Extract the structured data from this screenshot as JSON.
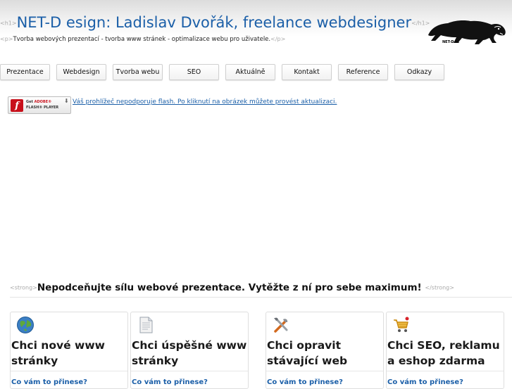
{
  "header": {
    "h1_open_tag": "<h1>",
    "title": "NET-D esign: Ladislav Dvořák, freelance webdesigner",
    "h1_close_tag": "</h1>",
    "p_open_tag": "<p>",
    "subtitle": "Tvorba webových prezentací - tvorba www stránek - optimalizace webu pro uživatele.",
    "p_close_tag": "</p>",
    "logo_text": "NET-D.cz"
  },
  "nav": {
    "items": [
      {
        "label": "Prezentace"
      },
      {
        "label": "Webdesign"
      },
      {
        "label": "Tvorba webu"
      },
      {
        "label": "SEO"
      },
      {
        "label": "Aktuálně"
      },
      {
        "label": "Kontakt"
      },
      {
        "label": "Reference"
      },
      {
        "label": "Odkazy"
      }
    ]
  },
  "flash": {
    "badge_get": "Get",
    "badge_adobe": "ADOBE®",
    "badge_player": "FLASH® PLAYER",
    "message": "Váš prohlížeč nepodporuje flash. Po kliknutí na obrázek můžete provést aktualizaci."
  },
  "tagline": {
    "strong_open_tag": "<strong>",
    "text": "Nepodceňujte sílu webové prezentace. Vytěžte z ní pro sebe maximum!",
    "strong_close_tag": "</strong>"
  },
  "cards": [
    {
      "title": "Chci nové www stránky",
      "link": "Co vám to přinese?",
      "icon": "globe-icon"
    },
    {
      "title": "Chci úspěšné www stránky",
      "link": "Co vám to přinese?",
      "icon": "document-icon"
    },
    {
      "title": "Chci opravit stávající web",
      "link": "Co vám to přinese?",
      "icon": "tools-icon"
    },
    {
      "title": "Chci SEO, reklamu a eshop zdarma",
      "link": "Co vám to přinese?",
      "icon": "shopping-cart-icon"
    }
  ],
  "colors": {
    "link": "#1b5fa8",
    "flash_red": "#c8101b"
  }
}
